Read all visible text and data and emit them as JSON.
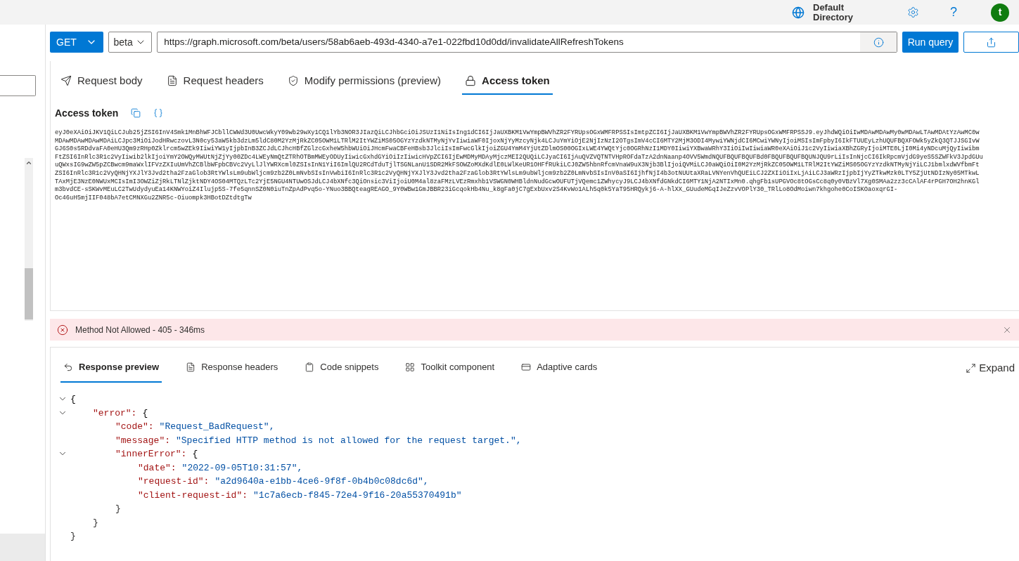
{
  "header": {
    "directory": "Default Directory",
    "avatar": "t",
    "help": "?"
  },
  "query": {
    "method": "GET",
    "version": "beta",
    "url": "https://graph.microsoft.com/beta/users/58ab6aeb-493d-4340-a7e1-022fbd10d0dd/invalidateAllRefreshTokens",
    "run_button": "Run query"
  },
  "request_tabs": [
    {
      "label": "Request body",
      "selected": false
    },
    {
      "label": "Request headers",
      "selected": false
    },
    {
      "label": "Modify permissions (preview)",
      "selected": false
    },
    {
      "label": "Access token",
      "selected": true
    }
  ],
  "access_token": {
    "title": "Access token",
    "lines": [
      "eyJ0eXAiOiJKV1QiLCJub25jZSI6InV4Smk1MnBhWFJCbllCWWd3U0UwcWkyY09wb29wXy1CQ1lYb3NOR3JIazQiLCJhbGciOiJSUzI1NiIsIng1dCI6IjJaUXBKM1VwYmpBWVhZR2FYRUpsOGxWMFRPSSIsImtpZCI6IjJaUXBKM1VwYmpBWVhZR2FYRUpsOGxWMFRPSSJ9.eyJhdWQiOiIwMDAwMDAwMy0wMDAwLTAwMDAtYzAwMC0w",
      "MDAwMDAwMDAwMDAiLCJpc3MiOiJodHRwczovL3N0cy53aW5kb3dzLm5ldC80M2YzMjRkZC05OWM1LTRlM2ItYWZiMS05OGYzYzdkNTMyNjYvIiwiaWF0IjoxNjYyMzcyNjk4LCJuYmYiOjE2NjIzNzI2OTgsImV4cCI6MTY2MjM3ODI4MywiYWNjdCI6MCwiYWNyIjoiMSIsImFpbyI6IkFTUUEyLzhUQUFBQXFOWk5yZkQ3QTJJSGIvW",
      "GJ6S0s5RDdvaFA0eHU3Qm9zRHp0Zklrcm5wZEk9IiwiYW1yIjpbInB3ZCJdLCJhcHBfZGlzcGxheW5hbWUiOiJHcmFwaCBFeHBsb3JlciIsImFwcGlkIjoiZGU4YmM4YjUtZDlmOS00OGIxLWE4YWQtYjc0OGRhNzI1MDY0IiwiYXBwaWRhY3IiOiIwIiwiaWR0eXAiOiJ1c2VyIiwiaXBhZGRyIjoiMTE0LjI0Mi4yNDcuMjQyIiwibm",
      "FtZSI6InRlc3R1c2VyIiwib2lkIjoiYmY2OWQyMWUtNjZjYy00ZDc4LWEyNmQtZTRhOTBmMWEyODUyIiwicGxhdGYiOiIzIiwicHVpZCI6IjEwMDMyMDAyMjczMEI2QUQiLCJyaCI6IjAuQVZVQTNTVHpROFdaTzA2dnNaanp4OVV5WmdNQUFBQUFBQUFBd0FBQUFBQUFBQUNJQU9rLiIsInNjcCI6IkRpcmVjdG9yeS5SZWFkV3JpdGUu",
      "uQWxsIG9wZW5pZCBwcm9maWxlIFVzZXIuUmVhZCBlbWFpbCBVc2VyLlJlYWRXcml0ZSIsInN1YiI6ImlQU2RCdTduTjlTSGNLanU1SDR2MkFSOWZoMXdKdlE0LWlKeUR1OHFfRUkiLCJ0ZW5hbnRfcmVnaW9uX3Njb3BlIjoiQVMiLCJ0aWQiOiI0M2YzMjRkZC05OWM1LTRlM2ItYWZiMS05OGYzYzdkNTMyNjYiLCJ1bmlxdWVfbmFt",
      "ZSI6InRlc3R1c2VyQHNjYXJlY3Jvd2tha2FzaGlob3RtYWlsLm9ubWljcm9zb2Z0LmNvbSIsInVwbiI6InRlc3R1c2VyQHNjYXJlY3Jvd2tha2FzaGlob3RtYWlsLm9ubWljcm9zb2Z0LmNvbSIsInV0aSI6IjhfNjI4b3otNUUtaXRaLVNYenVhQUEiLCJ2ZXIiOiIxLjAiLCJ3aWRzIjpbIjYyZTkwMzk0LTY5ZjUtNDIzNy05MTkwL",
      "TAxMjE3NzE0NWUxMCIsImI3OWZiZjRkLTNlZjktNDY4OS04MTQzLTc2YjE5NGU4NTUwOSJdLCJ4bXNfc3QiOnsic3ViIjoiU0M4al8zaFMzLVEzRmxhb1VSWGN0WHBldnNudGcwOUFUTjVQemc1ZWhycyJ9LCJ4bXNfdGNkdCI6MTY1NjA2NTIxMn0.qhgFb1sUPGVOc8tOGsCc8q0y0VBzVl7Xg0SMAa2zz3cCAlAF4rPGH7OH2hnKGl",
      "m3bvdCE-sSKWvMEuLC2TwUdydyuEa14KNWYoiZ4Ilujp5S-7fe5qnnSZ0N0iuTnZpAdPvq5o-YNuo3BBQteagREAGO_9Y0WBw1GmJBBR23iGcqokHb4Nu_k8gFa0jC7gExbUxv2S4KvWo1ALh5q0k5YaT95HRQykj6-A-hlXX_GUudeMGqIJeZzvVOPlY30_TRlLo8OdMoiwn7khgohe0CoISKOaoxqrGI-",
      "Oc46uH5mjIIF048bA7etCMNXGu2ZNR5c-Oiuompk3HBotDZtdtgTw"
    ]
  },
  "status": {
    "message": "Method Not Allowed - 405 - 346ms",
    "kind": "error"
  },
  "response_tabs": [
    {
      "label": "Response preview",
      "selected": true
    },
    {
      "label": "Response headers",
      "selected": false
    },
    {
      "label": "Code snippets",
      "selected": false
    },
    {
      "label": "Toolkit component",
      "selected": false
    },
    {
      "label": "Adaptive cards",
      "selected": false
    }
  ],
  "expand_button": "Expand",
  "response": {
    "open": "{",
    "expanded": true,
    "close": "}",
    "children": [
      {
        "key": "\"error\":",
        "open": "{",
        "expanded": true,
        "close": "}",
        "children": [
          {
            "key": "\"code\":",
            "value": "\"Request_BadRequest\","
          },
          {
            "key": "\"message\":",
            "value": "\"Specified HTTP method is not allowed for the request target.\","
          },
          {
            "key": "\"innerError\":",
            "open": "{",
            "expanded": true,
            "close": "}",
            "children": [
              {
                "key": "\"date\":",
                "value": "\"2022-09-05T10:31:57\","
              },
              {
                "key": "\"request-id\":",
                "value": "\"a2d9640a-e1bb-4ce6-9f8f-0b4b0c08dc6d\","
              },
              {
                "key": "\"client-request-id\":",
                "value": "\"1c7a6ecb-f845-72e4-9f16-20a55370491b\""
              }
            ]
          }
        ]
      }
    ]
  }
}
